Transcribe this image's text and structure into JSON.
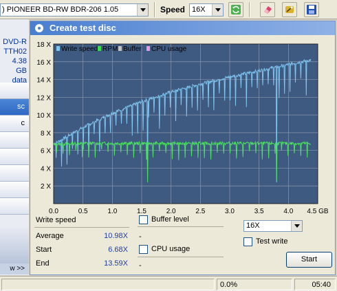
{
  "toolbar": {
    "drive": ") PIONEER BD-RW  BDR-206 1.05",
    "speed_label": "Speed",
    "speed_value": "16X",
    "buttons": [
      "refresh-icon",
      "eraser-icon",
      "wand-icon",
      "save-icon"
    ]
  },
  "sidebar": {
    "disc_type": "DVD-R",
    "disc_id": "TTH02",
    "capacity": "4.38 GB",
    "data_label": "data",
    "active_tab": "sc",
    "tab2": "c",
    "more": "w >>"
  },
  "panel": {
    "title": "Create test disc",
    "legend": [
      "Write speed",
      "RPM",
      "Buffer",
      "CPU usage"
    ]
  },
  "colors": {
    "graph_bg": "#3f5a80",
    "grid": "#8a96ac",
    "speed_line": "#7fc6f2",
    "rpm_line": "#49e35d",
    "rpm_legend": "#3ddc4c",
    "buffer_legend": "#c4c4c4",
    "cpu_legend": "#e79be6"
  },
  "chart_data": {
    "type": "line",
    "xlim": [
      0,
      4.5
    ],
    "ylim": [
      0,
      18
    ],
    "x_ticks": [
      "0.0",
      "0.5",
      "1.0",
      "1.5",
      "2.0",
      "2.5",
      "3.0",
      "3.5",
      "4.0",
      "4.5 GB"
    ],
    "y_ticks": [
      "2 X",
      "4 X",
      "6 X",
      "8 X",
      "10 X",
      "12 X",
      "14 X",
      "16 X",
      "18 X"
    ],
    "series": [
      {
        "name": "Write speed",
        "x": [
          0,
          0.5,
          1.0,
          1.5,
          2.0,
          2.5,
          3.0,
          3.5,
          4.0,
          4.38
        ],
        "y": [
          6.7,
          8.6,
          10.2,
          11.5,
          12.6,
          13.5,
          14.3,
          15.0,
          15.7,
          16.2
        ]
      },
      {
        "name": "RPM",
        "x": [
          0,
          0.5,
          1.0,
          1.5,
          2.0,
          2.5,
          3.0,
          3.5,
          4.0,
          4.38
        ],
        "y": [
          6.7,
          6.8,
          6.8,
          6.8,
          6.8,
          6.8,
          6.8,
          6.8,
          6.8,
          6.8
        ]
      }
    ]
  },
  "stats": {
    "heading": "Write speed",
    "average_label": "Average",
    "average_value": "10.98X",
    "start_label": "Start",
    "start_value": "6.68X",
    "end_label": "End",
    "end_value": "13.59X"
  },
  "options": {
    "buffer_level": "Buffer level",
    "cpu_usage": "CPU usage",
    "dash": "-",
    "write_speed": "16X",
    "test_write": "Test write",
    "start": "Start"
  },
  "status": {
    "progress": "0.0%",
    "time": "05:40"
  }
}
